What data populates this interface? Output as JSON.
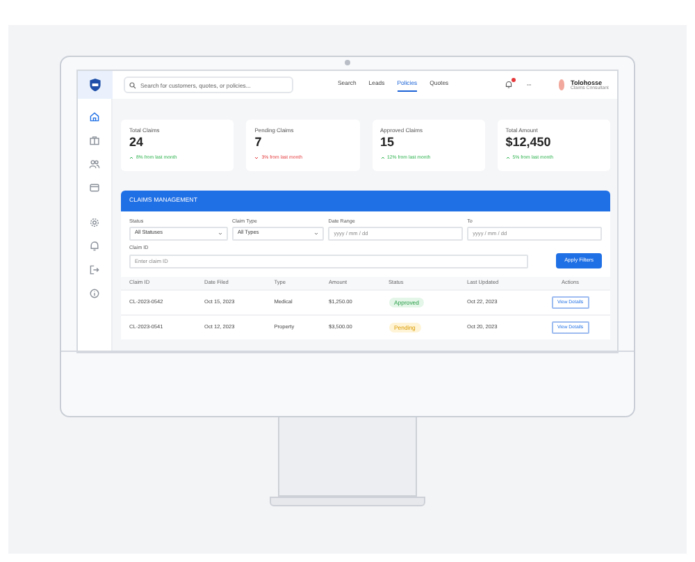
{
  "sidebar": {
    "items": [
      {
        "kind": "home",
        "selected": true
      },
      {
        "kind": "briefcase",
        "selected": false
      },
      {
        "kind": "users",
        "selected": false
      },
      {
        "kind": "card",
        "selected": false
      },
      {
        "kind": "gear",
        "selected": false
      },
      {
        "kind": "bell",
        "selected": false
      },
      {
        "kind": "logout",
        "selected": false
      },
      {
        "kind": "info",
        "selected": false
      }
    ]
  },
  "search": {
    "placeholder": "Search for customers, quotes, or policies..."
  },
  "nav": [
    {
      "label": "Search",
      "selected": false
    },
    {
      "label": "Leads",
      "selected": false
    },
    {
      "label": "Policies",
      "selected": true
    },
    {
      "label": "Quotes",
      "selected": false
    }
  ],
  "user": {
    "name": "Tolohosse",
    "role": "Claims Consultant"
  },
  "stats": [
    {
      "label": "Total Claims",
      "value": "24",
      "change": "8% from last month",
      "kind": "up"
    },
    {
      "label": "Pending Claims",
      "value": "7",
      "change": "3% from last month",
      "kind": "down"
    },
    {
      "label": "Approved Claims",
      "value": "15",
      "change": "12% from last month",
      "kind": "up"
    },
    {
      "label": "Total Amount",
      "value": "$12,450",
      "change": "5% from last month",
      "kind": "up"
    }
  ],
  "claims": {
    "title": "CLAIMS MANAGEMENT",
    "filters": [
      {
        "label": "Status",
        "kind": "select",
        "value": "All Statuses"
      },
      {
        "label": "Claim Type",
        "kind": "select",
        "value": "All Types"
      },
      {
        "label": "Date Range",
        "kind": "date",
        "placeholder": "yyyy / mm / dd"
      },
      {
        "label": "To",
        "kind": "date",
        "placeholder": "yyyy / mm / dd"
      }
    ],
    "claim_id": {
      "label": "Claim ID",
      "placeholder": "Enter claim ID"
    },
    "apply_button": "Apply Filters",
    "table": {
      "columns": [
        "Claim ID",
        "Date Filed",
        "Type",
        "Amount",
        "Status",
        "Last Updated",
        "Actions"
      ],
      "rows": [
        {
          "claim_id": "CL-2023-0542",
          "date_filed": "Oct 15, 2023",
          "type": "Medical",
          "amount": "$1,250.00",
          "status": {
            "label": "Approved",
            "kind": "approved"
          },
          "last_updated": "Oct 22, 2023",
          "action": "View Details"
        },
        {
          "claim_id": "CL-2023-0541",
          "date_filed": "Oct 12, 2023",
          "type": "Property",
          "amount": "$3,500.00",
          "status": {
            "label": "Pending",
            "kind": "pending"
          },
          "last_updated": "Oct 20, 2023",
          "action": "View Details"
        }
      ]
    }
  }
}
